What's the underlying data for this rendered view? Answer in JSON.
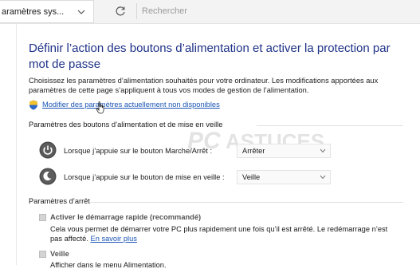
{
  "toolbar": {
    "breadcrumb_label": "aramètres sys...",
    "search_placeholder": "Rechercher"
  },
  "page": {
    "title": "Définir l’action des boutons d’alimentation et activer la protection par mot de passe",
    "description": "Choisissez les paramètres d’alimentation souhaités pour votre ordinateur. Les modifications apportées aux paramètres de cette page s’appliquent à tous vos modes de gestion de l’alimentation.",
    "modify_link": "Modifier des paramètres actuellement non disponibles"
  },
  "buttons_section": {
    "title": "Paramètres des boutons d’alimentation et de mise en veille",
    "rows": [
      {
        "label": "Lorsque j’appuie sur le bouton Marche/Arrêt :",
        "value": "Arrêter"
      },
      {
        "label": "Lorsque j’appuie sur le bouton de mise en veille :",
        "value": "Veille"
      }
    ]
  },
  "shutdown_section": {
    "title": "Paramètres d’arrêt",
    "fast_startup": {
      "label": "Activer le démarrage rapide (recommandé)",
      "description": "Cela vous permet de démarrer votre PC plus rapidement une fois qu’il est arrêté. Le redémarrage n’est pas affecté.",
      "learn_more": "En savoir plus"
    },
    "sleep": {
      "label": "Veille",
      "description": "Afficher dans le menu Alimentation."
    }
  },
  "watermark": {
    "text": "PC ASTUCES"
  },
  "colors": {
    "title": "#1e3287",
    "link": "#1a55b5"
  },
  "icons": [
    "chevron-down-icon",
    "refresh-icon",
    "shield-icon",
    "cursor-icon",
    "power-button-icon",
    "sleep-button-icon"
  ]
}
